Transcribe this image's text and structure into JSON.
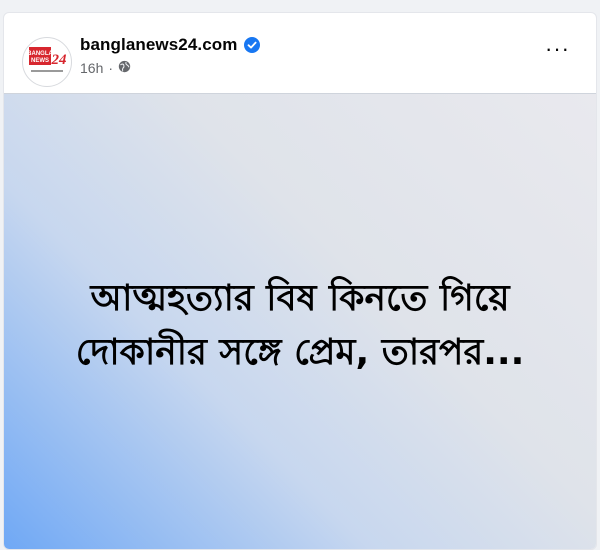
{
  "post": {
    "page_name": "banglanews24.com",
    "time": "16h",
    "more_label": "···",
    "logo_text": "BANGLA NEWS",
    "logo_number": "24",
    "headline_line1": "আত্মহত্যার বিষ কিনতে গিয়ে",
    "headline_line2": "দোকানীর সঙ্গে প্রেম, তারপর..."
  },
  "colors": {
    "verified": "#1877f2",
    "logo_red": "#d7262e",
    "meta_text": "#65676b"
  },
  "icons": [
    "verified-badge-icon",
    "globe-icon",
    "more-options-icon"
  ]
}
